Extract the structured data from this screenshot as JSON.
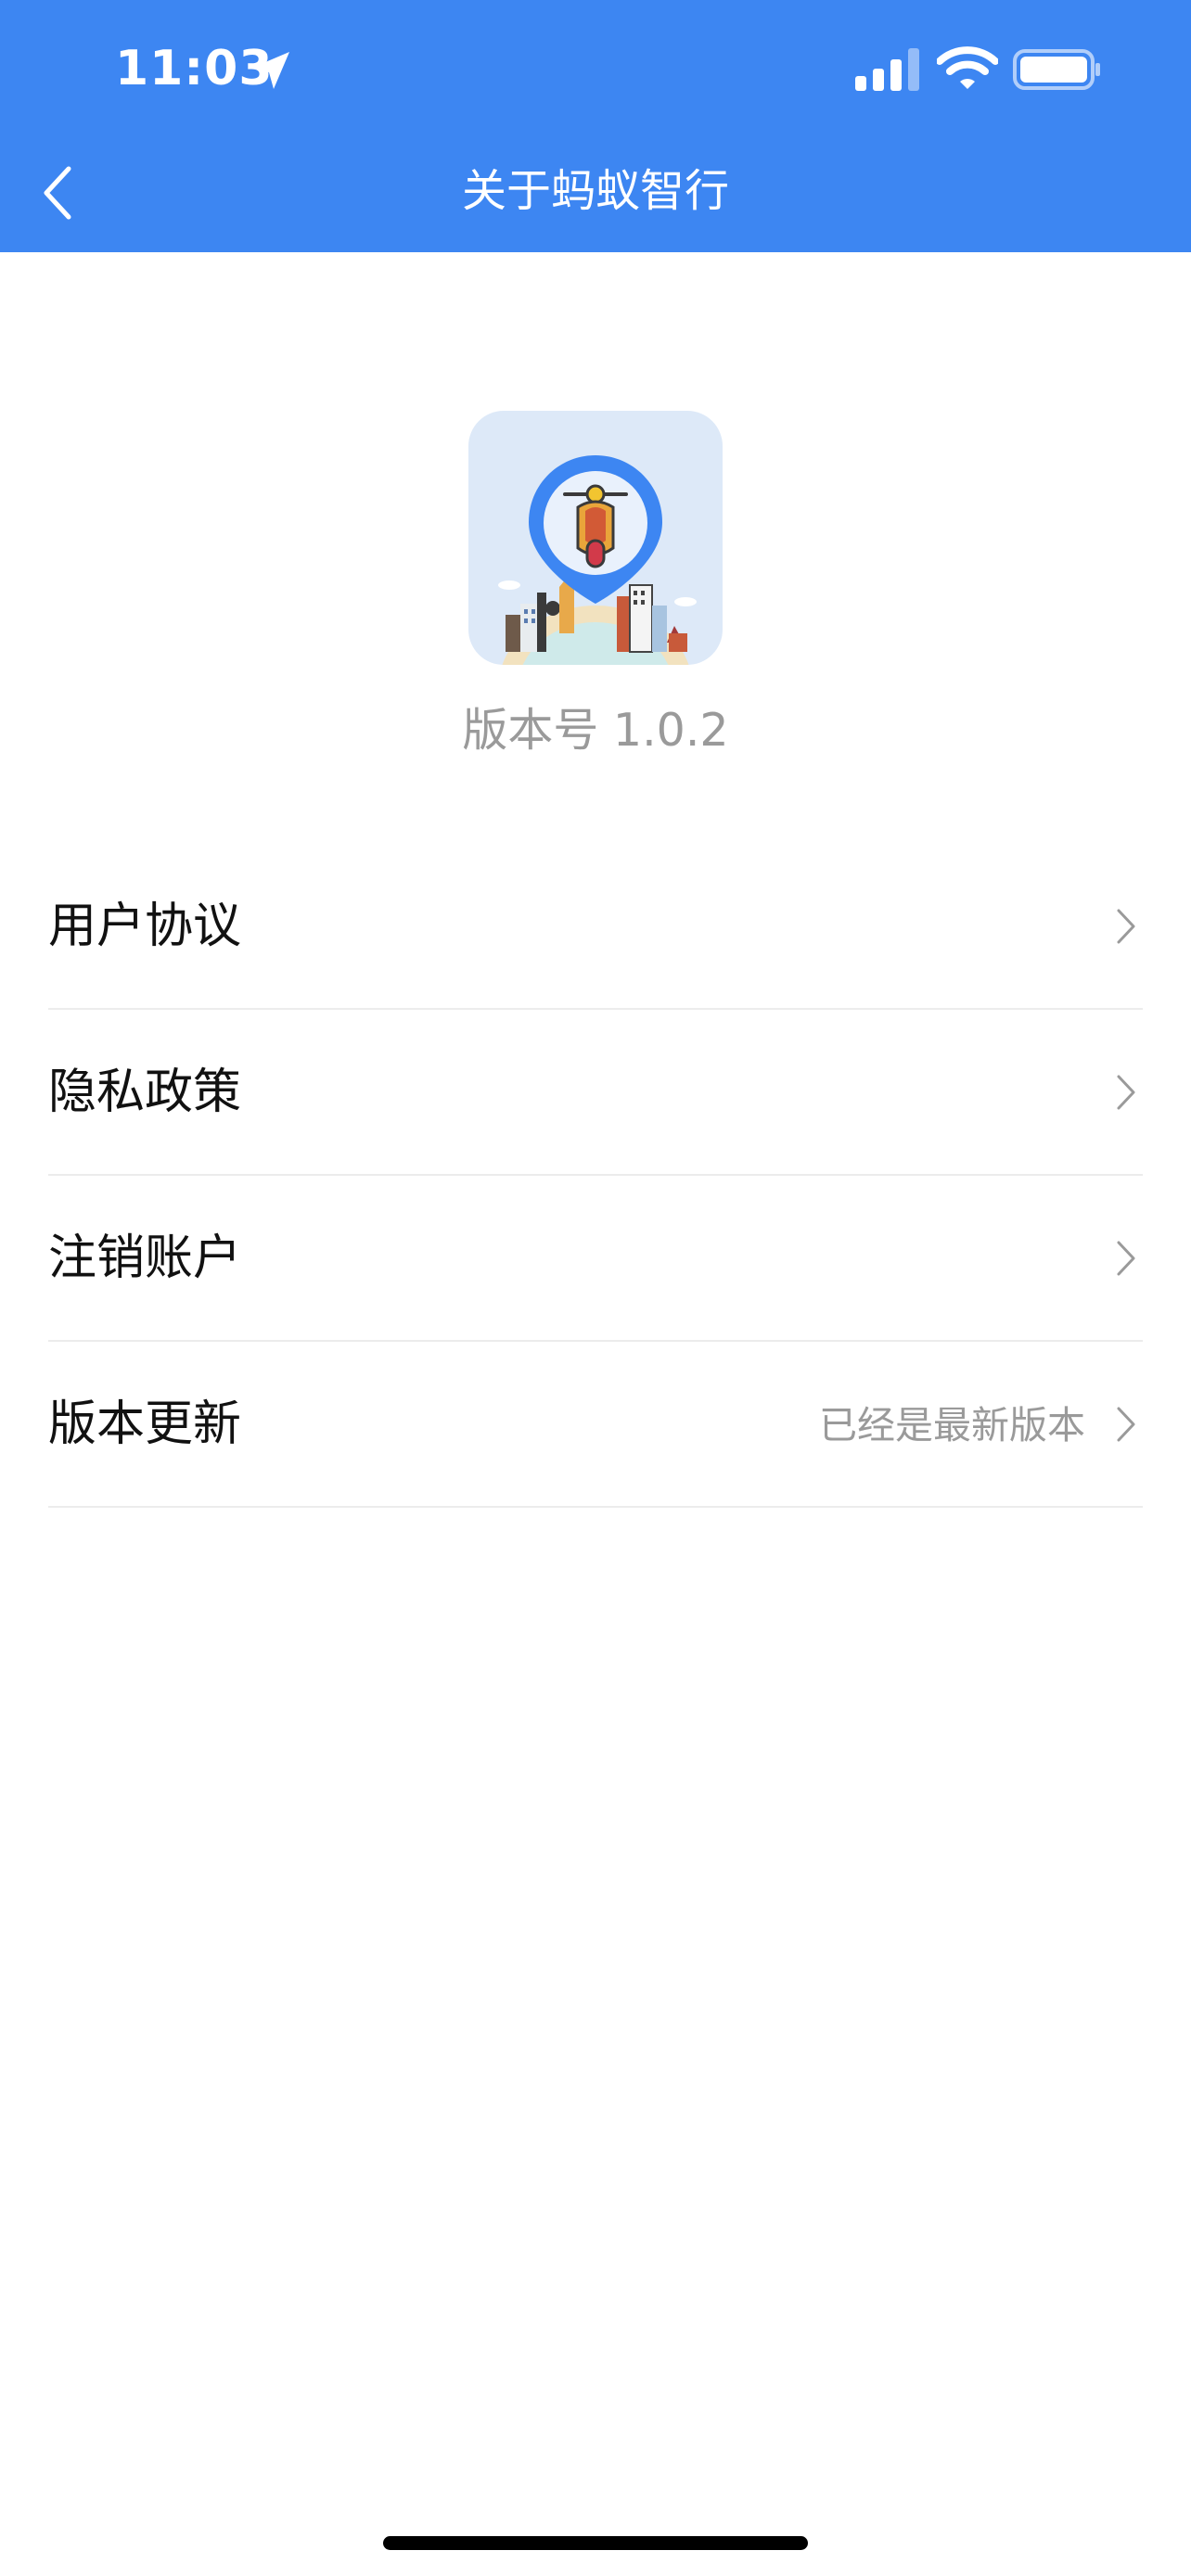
{
  "status_bar": {
    "time": "11:03"
  },
  "nav": {
    "title": "关于蚂蚁智行"
  },
  "about": {
    "version_text": "版本号 1.0.2"
  },
  "menu": {
    "items": [
      {
        "label": "用户协议",
        "value": ""
      },
      {
        "label": "隐私政策",
        "value": ""
      },
      {
        "label": "注销账户",
        "value": ""
      },
      {
        "label": "版本更新",
        "value": "已经是最新版本"
      }
    ]
  },
  "colors": {
    "header": "#3d86f2",
    "pin": "#3d86f2",
    "logo_bg": "#dde9f8"
  }
}
